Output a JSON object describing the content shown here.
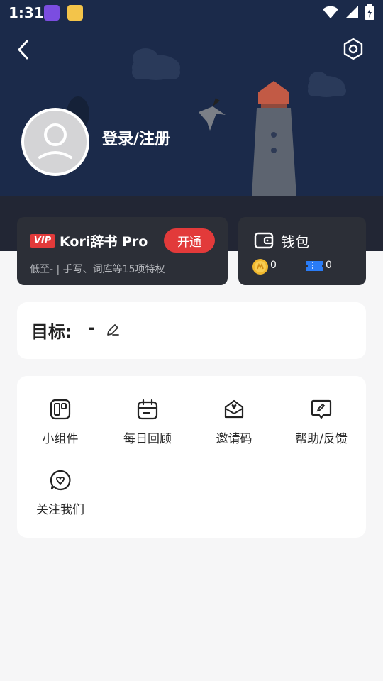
{
  "status_bar": {
    "time": "1:31"
  },
  "header": {
    "login_label": "登录/注册"
  },
  "vip_card": {
    "badge": "VIP",
    "title": "Kori辞书 Pro",
    "button": "开通",
    "description": "低至- | 手写、词库等15项特权"
  },
  "wallet_card": {
    "label": "钱包",
    "coins": "0",
    "tickets": "0"
  },
  "goal": {
    "label": "目标:",
    "value": "-"
  },
  "tools": [
    {
      "label": "小组件",
      "icon": "widget-icon"
    },
    {
      "label": "每日回顾",
      "icon": "calendar-icon"
    },
    {
      "label": "邀请码",
      "icon": "invite-icon"
    },
    {
      "label": "帮助/反馈",
      "icon": "feedback-icon"
    },
    {
      "label": "关注我们",
      "icon": "follow-icon"
    }
  ],
  "colors": {
    "hero_bg": "#1b2a4a",
    "card_dark": "#2c2f37",
    "accent_red": "#e23a3a",
    "page_bg": "#f6f6f7"
  }
}
